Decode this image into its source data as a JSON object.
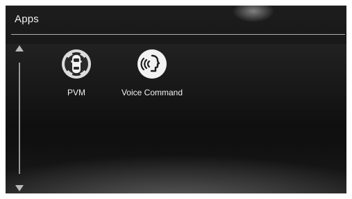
{
  "screen": {
    "title": "Apps"
  },
  "scroll": {
    "up_icon": "triangle-up",
    "down_icon": "triangle-down"
  },
  "apps": [
    {
      "label": "PVM",
      "icon": "parking-sensors-car-icon"
    },
    {
      "label": "Voice Command",
      "icon": "voice-command-icon"
    }
  ]
}
